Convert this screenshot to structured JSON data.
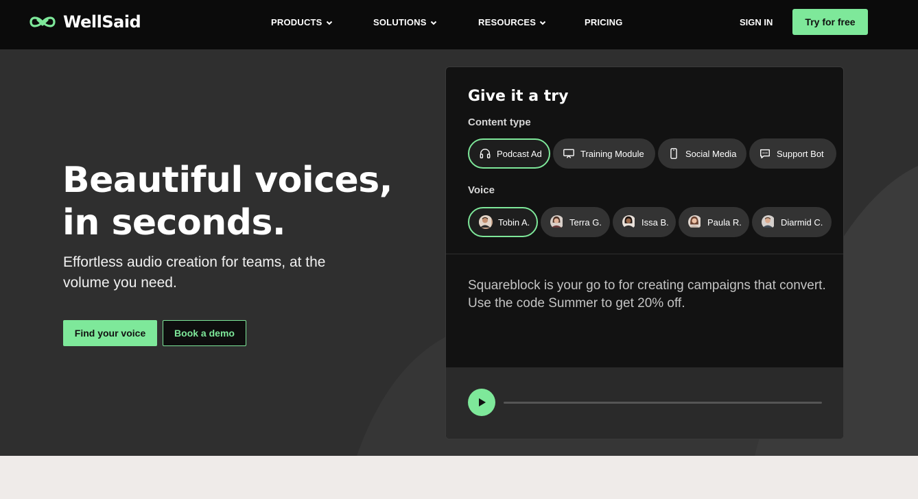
{
  "nav": {
    "brand": "WellSaid",
    "menu": [
      {
        "label": "PRODUCTS",
        "has_dropdown": true
      },
      {
        "label": "SOLUTIONS",
        "has_dropdown": true
      },
      {
        "label": "RESOURCES",
        "has_dropdown": true
      },
      {
        "label": "PRICING",
        "has_dropdown": false
      }
    ],
    "sign_in": "SIGN IN",
    "cta": "Try for free"
  },
  "hero": {
    "headline_line1": "Beautiful voices,",
    "headline_line2": "in seconds.",
    "subhead": "Effortless audio creation for teams, at the volume you need.",
    "primary_button": "Find your voice",
    "secondary_button": "Book a demo"
  },
  "demo": {
    "title": "Give it a try",
    "content_type_label": "Content type",
    "content_types": [
      {
        "label": "Podcast Ad",
        "icon": "headphones-icon",
        "selected": true
      },
      {
        "label": "Training Module",
        "icon": "presentation-icon",
        "selected": false
      },
      {
        "label": "Social Media",
        "icon": "phone-icon",
        "selected": false
      },
      {
        "label": "Support Bot",
        "icon": "chat-icon",
        "selected": false
      }
    ],
    "voice_label": "Voice",
    "voices": [
      {
        "label": "Tobin A.",
        "selected": true
      },
      {
        "label": "Terra G.",
        "selected": false
      },
      {
        "label": "Issa B.",
        "selected": false
      },
      {
        "label": "Paula R.",
        "selected": false
      },
      {
        "label": "Diarmid C.",
        "selected": false
      }
    ],
    "script": "Squareblock is your go to for creating campaigns that convert. Use the code Summer to get 20% off.",
    "playback_progress": 0,
    "play_icon": "play-icon"
  },
  "colors": {
    "accent": "#7ee89a",
    "nav_bg": "#0b0b0b",
    "hero_bg": "#2f2f2f",
    "panel_bg": "#121212",
    "chip_bg": "#333333",
    "page_bg": "#efebe9"
  }
}
